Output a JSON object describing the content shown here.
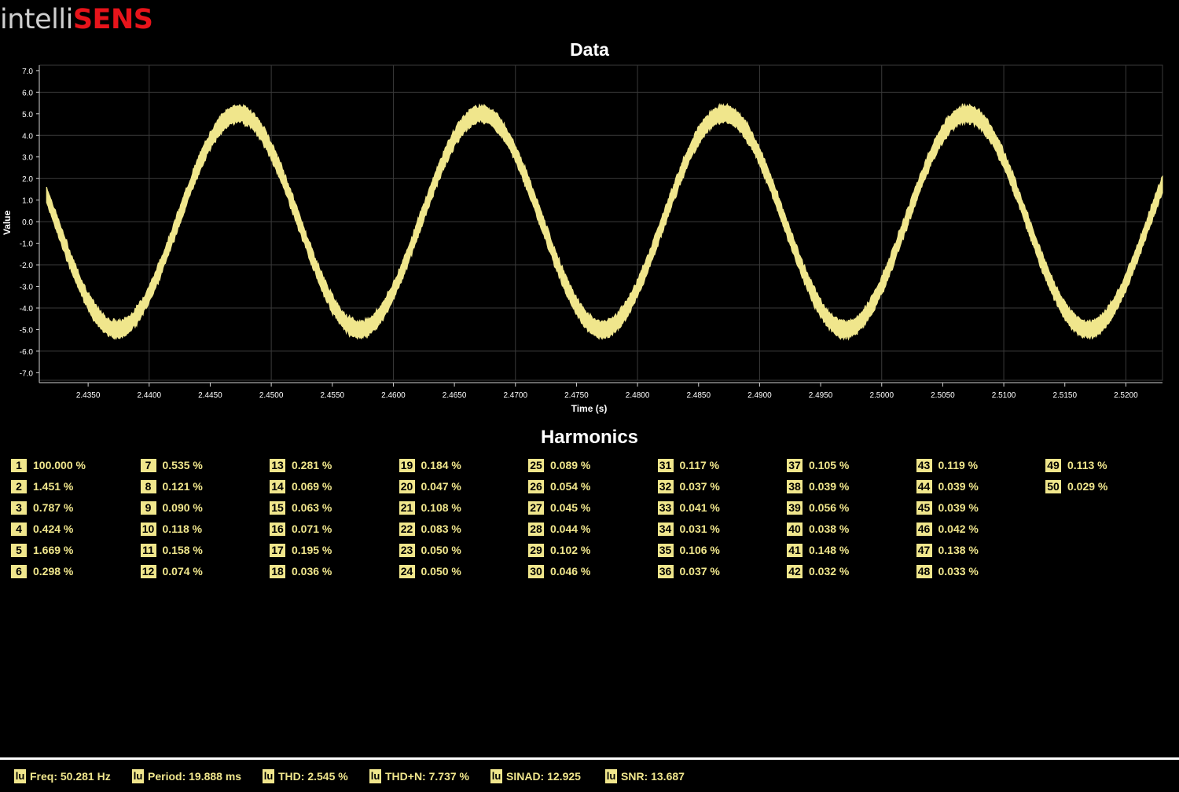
{
  "logo": {
    "part1": "intelli",
    "part2": "SENS"
  },
  "chart_data": {
    "type": "line",
    "title": "Data",
    "xlabel": "Time (s)",
    "ylabel": "Value",
    "xlim": [
      2.431,
      2.523
    ],
    "ylim": [
      -7.35,
      7.25
    ],
    "x_ticks": [
      "2.4350",
      "2.4400",
      "2.4450",
      "2.4500",
      "2.4550",
      "2.4600",
      "2.4650",
      "2.4700",
      "2.4750",
      "2.4800",
      "2.4850",
      "2.4900",
      "2.4950",
      "2.5000",
      "2.5050",
      "2.5100",
      "2.5150",
      "2.5200"
    ],
    "y_ticks": [
      "7.0",
      "6.0",
      "5.0",
      "4.0",
      "3.0",
      "2.0",
      "1.0",
      "0.0",
      "-1.0",
      "-2.0",
      "-3.0",
      "-4.0",
      "-5.0",
      "-6.0",
      "-7.0"
    ],
    "grid": true,
    "series": [
      {
        "frequency_hz": 50.281,
        "amplitude": 5.0,
        "peak_time_s": 2.4473,
        "band_width": 0.65,
        "color": "#f0e68c"
      }
    ]
  },
  "harmonics": {
    "title": "Harmonics",
    "items": [
      {
        "n": "1",
        "v": "100.000 %"
      },
      {
        "n": "2",
        "v": "1.451 %"
      },
      {
        "n": "3",
        "v": "0.787 %"
      },
      {
        "n": "4",
        "v": "0.424 %"
      },
      {
        "n": "5",
        "v": "1.669 %"
      },
      {
        "n": "6",
        "v": "0.298 %"
      },
      {
        "n": "7",
        "v": "0.535 %"
      },
      {
        "n": "8",
        "v": "0.121 %"
      },
      {
        "n": "9",
        "v": "0.090 %"
      },
      {
        "n": "10",
        "v": "0.118 %"
      },
      {
        "n": "11",
        "v": "0.158 %"
      },
      {
        "n": "12",
        "v": "0.074 %"
      },
      {
        "n": "13",
        "v": "0.281 %"
      },
      {
        "n": "14",
        "v": "0.069 %"
      },
      {
        "n": "15",
        "v": "0.063 %"
      },
      {
        "n": "16",
        "v": "0.071 %"
      },
      {
        "n": "17",
        "v": "0.195 %"
      },
      {
        "n": "18",
        "v": "0.036 %"
      },
      {
        "n": "19",
        "v": "0.184 %"
      },
      {
        "n": "20",
        "v": "0.047 %"
      },
      {
        "n": "21",
        "v": "0.108 %"
      },
      {
        "n": "22",
        "v": "0.083 %"
      },
      {
        "n": "23",
        "v": "0.050 %"
      },
      {
        "n": "24",
        "v": "0.050 %"
      },
      {
        "n": "25",
        "v": "0.089 %"
      },
      {
        "n": "26",
        "v": "0.054 %"
      },
      {
        "n": "27",
        "v": "0.045 %"
      },
      {
        "n": "28",
        "v": "0.044 %"
      },
      {
        "n": "29",
        "v": "0.102 %"
      },
      {
        "n": "30",
        "v": "0.046 %"
      },
      {
        "n": "31",
        "v": "0.117 %"
      },
      {
        "n": "32",
        "v": "0.037 %"
      },
      {
        "n": "33",
        "v": "0.041 %"
      },
      {
        "n": "34",
        "v": "0.031 %"
      },
      {
        "n": "35",
        "v": "0.106 %"
      },
      {
        "n": "36",
        "v": "0.037 %"
      },
      {
        "n": "37",
        "v": "0.105 %"
      },
      {
        "n": "38",
        "v": "0.039 %"
      },
      {
        "n": "39",
        "v": "0.056 %"
      },
      {
        "n": "40",
        "v": "0.038 %"
      },
      {
        "n": "41",
        "v": "0.148 %"
      },
      {
        "n": "42",
        "v": "0.032 %"
      },
      {
        "n": "43",
        "v": "0.119 %"
      },
      {
        "n": "44",
        "v": "0.039 %"
      },
      {
        "n": "45",
        "v": "0.039 %"
      },
      {
        "n": "46",
        "v": "0.042 %"
      },
      {
        "n": "47",
        "v": "0.138 %"
      },
      {
        "n": "48",
        "v": "0.033 %"
      },
      {
        "n": "49",
        "v": "0.113 %"
      },
      {
        "n": "50",
        "v": "0.029 %"
      }
    ]
  },
  "status": {
    "icon_text": "lu",
    "items": [
      {
        "label": "Freq: 50.281 Hz"
      },
      {
        "label": "Period: 19.888 ms"
      },
      {
        "label": "THD: 2.545 %"
      },
      {
        "label": "THD+N: 7.737 %"
      },
      {
        "label": "SINAD: 12.925"
      },
      {
        "label": "SNR: 13.687"
      }
    ]
  }
}
